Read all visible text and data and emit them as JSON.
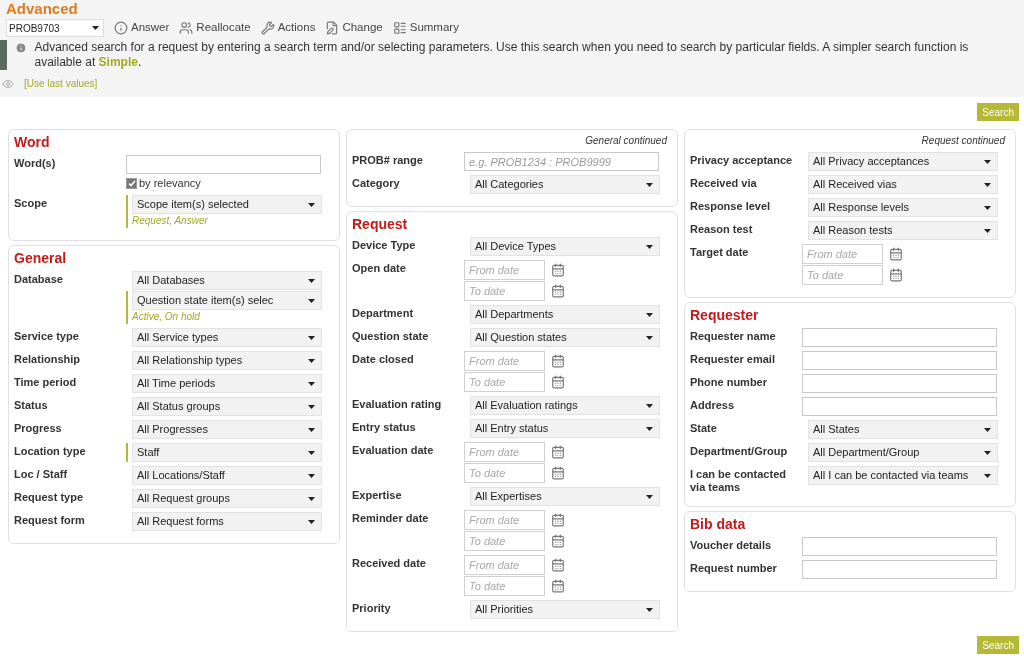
{
  "title": "Advanced",
  "toolbar": {
    "record": "PROB9703",
    "actions": [
      {
        "kind": "info",
        "label": "Answer"
      },
      {
        "kind": "people",
        "label": "Reallocate"
      },
      {
        "kind": "tools",
        "label": "Actions"
      },
      {
        "kind": "edit",
        "label": "Change"
      },
      {
        "kind": "list",
        "label": "Summary"
      }
    ]
  },
  "info": {
    "text": "Advanced search for a request by entering a search term and/or selecting parameters. Use this search when you need to search by particular fields. A simpler search function is available at ",
    "link": "Simple",
    "after": "."
  },
  "use_last_values": "[Use last values]",
  "search_button_top": "Search",
  "search_button_bottom": "Search",
  "columns": [
    [
      {
        "title": "Word",
        "rows": [
          {
            "label": "Word(s)",
            "controls": [
              {
                "kind": "text"
              },
              {
                "kind": "checkbox",
                "label": "by relevancy",
                "checked": true
              }
            ]
          },
          {
            "label": "Scope",
            "controls": [
              {
                "kind": "select",
                "value": "Scope item(s) selected",
                "active": true,
                "note": "Request, Answer"
              }
            ]
          }
        ]
      },
      {
        "title": "General",
        "rows": [
          {
            "label": "Database",
            "controls": [
              {
                "kind": "select",
                "value": "All Databases",
                "active": false
              },
              {
                "kind": "select",
                "value": "Question state item(s) selec",
                "active": true,
                "note": "Active, On hold"
              }
            ]
          },
          {
            "label": "Service type",
            "controls": [
              {
                "kind": "select",
                "value": "All Service types",
                "active": false
              }
            ]
          },
          {
            "label": "Relationship",
            "controls": [
              {
                "kind": "select",
                "value": "All Relationship types",
                "active": false
              }
            ]
          },
          {
            "label": "Time period",
            "controls": [
              {
                "kind": "select",
                "value": "All Time periods",
                "active": false
              }
            ]
          },
          {
            "label": "Status",
            "controls": [
              {
                "kind": "select",
                "value": "All Status groups",
                "active": false
              }
            ]
          },
          {
            "label": "Progress",
            "controls": [
              {
                "kind": "select",
                "value": "All Progresses",
                "active": false
              }
            ]
          },
          {
            "label": "Location type",
            "controls": [
              {
                "kind": "select",
                "value": "Staff",
                "active": true
              }
            ]
          },
          {
            "label": "Loc / Staff",
            "controls": [
              {
                "kind": "select",
                "value": "All Locations/Staff",
                "active": false
              }
            ]
          },
          {
            "label": "Request type",
            "controls": [
              {
                "kind": "select",
                "value": "All Request groups",
                "active": false
              }
            ]
          },
          {
            "label": "Request form",
            "controls": [
              {
                "kind": "select",
                "value": "All Request forms",
                "active": false
              }
            ]
          }
        ]
      }
    ],
    [
      {
        "caption": "General continued",
        "rows": [
          {
            "label": "PROB# range",
            "controls": [
              {
                "kind": "text",
                "placeholder": "e.g. PROB1234 : PROB9999"
              }
            ]
          },
          {
            "label": "Category",
            "controls": [
              {
                "kind": "select",
                "value": "All Categories",
                "active": false
              }
            ]
          }
        ]
      },
      {
        "title": "Request",
        "rows": [
          {
            "label": "Device Type",
            "controls": [
              {
                "kind": "select",
                "value": "All Device Types",
                "active": false
              }
            ]
          },
          {
            "label": "Open date",
            "controls": [
              {
                "kind": "date",
                "placeholder": "From date"
              },
              {
                "kind": "date",
                "placeholder": "To date"
              }
            ]
          },
          {
            "label": "Department",
            "controls": [
              {
                "kind": "select",
                "value": "All Departments",
                "active": false
              }
            ]
          },
          {
            "label": "Question state",
            "controls": [
              {
                "kind": "select",
                "value": "All Question states",
                "active": false
              }
            ]
          },
          {
            "label": "Date closed",
            "controls": [
              {
                "kind": "date",
                "placeholder": "From date"
              },
              {
                "kind": "date",
                "placeholder": "To date"
              }
            ]
          },
          {
            "label": "Evaluation rating",
            "controls": [
              {
                "kind": "select",
                "value": "All Evaluation ratings",
                "active": false
              }
            ]
          },
          {
            "label": "Entry status",
            "controls": [
              {
                "kind": "select",
                "value": "All Entry status",
                "active": false
              }
            ]
          },
          {
            "label": "Evaluation date",
            "controls": [
              {
                "kind": "date",
                "placeholder": "From date"
              },
              {
                "kind": "date",
                "placeholder": "To date"
              }
            ]
          },
          {
            "label": "Expertise",
            "controls": [
              {
                "kind": "select",
                "value": "All Expertises",
                "active": false
              }
            ]
          },
          {
            "label": "Reminder date",
            "controls": [
              {
                "kind": "date",
                "placeholder": "From date"
              },
              {
                "kind": "date",
                "placeholder": "To date"
              }
            ]
          },
          {
            "label": "Received date",
            "controls": [
              {
                "kind": "date",
                "placeholder": "From date"
              },
              {
                "kind": "date",
                "placeholder": "To date"
              }
            ]
          },
          {
            "label": "Priority",
            "controls": [
              {
                "kind": "select",
                "value": "All Priorities",
                "active": false
              }
            ]
          }
        ]
      }
    ],
    [
      {
        "caption": "Request continued",
        "rows": [
          {
            "label": "Privacy acceptance",
            "controls": [
              {
                "kind": "select",
                "value": "All Privacy acceptances",
                "active": false
              }
            ]
          },
          {
            "label": "Received via",
            "controls": [
              {
                "kind": "select",
                "value": "All Received vias",
                "active": false
              }
            ]
          },
          {
            "label": "Response level",
            "controls": [
              {
                "kind": "select",
                "value": "All Response levels",
                "active": false
              }
            ]
          },
          {
            "label": "Reason test",
            "controls": [
              {
                "kind": "select",
                "value": "All Reason tests",
                "active": false
              }
            ]
          },
          {
            "label": "Target date",
            "controls": [
              {
                "kind": "date",
                "placeholder": "From date"
              },
              {
                "kind": "date",
                "placeholder": "To date"
              }
            ]
          }
        ]
      },
      {
        "title": "Requester",
        "rows": [
          {
            "label": "Requester name",
            "controls": [
              {
                "kind": "text"
              }
            ]
          },
          {
            "label": "Requester email",
            "controls": [
              {
                "kind": "text"
              }
            ]
          },
          {
            "label": "Phone number",
            "controls": [
              {
                "kind": "text"
              }
            ]
          },
          {
            "label": "Address",
            "controls": [
              {
                "kind": "text"
              }
            ]
          },
          {
            "label": "State",
            "controls": [
              {
                "kind": "select",
                "value": "All States",
                "active": false
              }
            ]
          },
          {
            "label": "Department/Group",
            "controls": [
              {
                "kind": "select",
                "value": "All Department/Group",
                "active": false
              }
            ]
          },
          {
            "label": "I can be contacted via teams",
            "controls": [
              {
                "kind": "select",
                "value": "All I can be contacted via teams",
                "active": false
              }
            ]
          }
        ]
      },
      {
        "title": "Bib data",
        "rows": [
          {
            "label": "Voucher details",
            "controls": [
              {
                "kind": "text"
              }
            ]
          },
          {
            "label": "Request number",
            "controls": [
              {
                "kind": "text"
              }
            ]
          }
        ]
      }
    ]
  ]
}
